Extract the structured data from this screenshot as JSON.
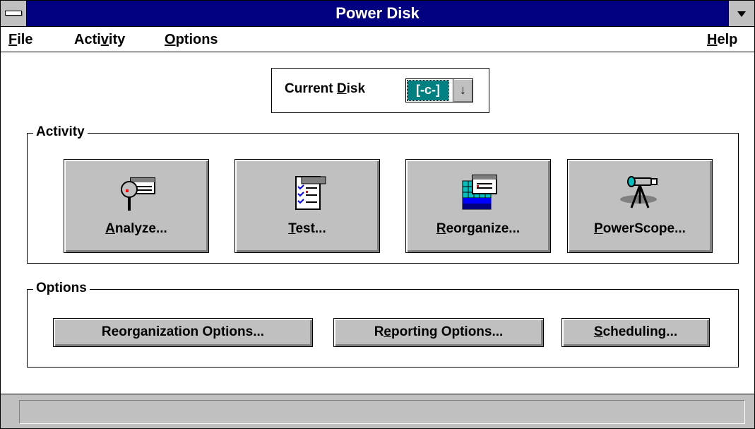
{
  "window": {
    "title": "Power Disk"
  },
  "menubar": {
    "file": {
      "pre": "",
      "ul": "F",
      "post": "ile"
    },
    "activity": {
      "pre": "Acti",
      "ul": "v",
      "post": "ity"
    },
    "options": {
      "pre": "",
      "ul": "O",
      "post": "ptions"
    },
    "help": {
      "pre": "",
      "ul": "H",
      "post": "elp"
    }
  },
  "current_disk": {
    "label_pre": "Current ",
    "label_ul": "D",
    "label_post": "isk",
    "value": "[-c-]",
    "arrow": "↓"
  },
  "activity": {
    "title": "Activity",
    "buttons": [
      {
        "pre": "",
        "ul": "A",
        "post": "nalyze...",
        "icon": "analyze-icon"
      },
      {
        "pre": "",
        "ul": "T",
        "post": "est...",
        "icon": "test-icon"
      },
      {
        "pre": "",
        "ul": "R",
        "post": "eorganize...",
        "icon": "reorganize-icon"
      },
      {
        "pre": "",
        "ul": "P",
        "post": "owerScope...",
        "icon": "powerscope-icon"
      }
    ]
  },
  "options": {
    "title": "Options",
    "buttons": [
      {
        "pre": "Reor",
        "ul": "g",
        "post": "anization Options..."
      },
      {
        "pre": "R",
        "ul": "e",
        "post": "porting Options..."
      },
      {
        "pre": "",
        "ul": "S",
        "post": "cheduling..."
      }
    ]
  },
  "status": {
    "text": ""
  },
  "colors": {
    "titlebar": "#000080",
    "face": "#c0c0c0",
    "selection": "#008080"
  }
}
